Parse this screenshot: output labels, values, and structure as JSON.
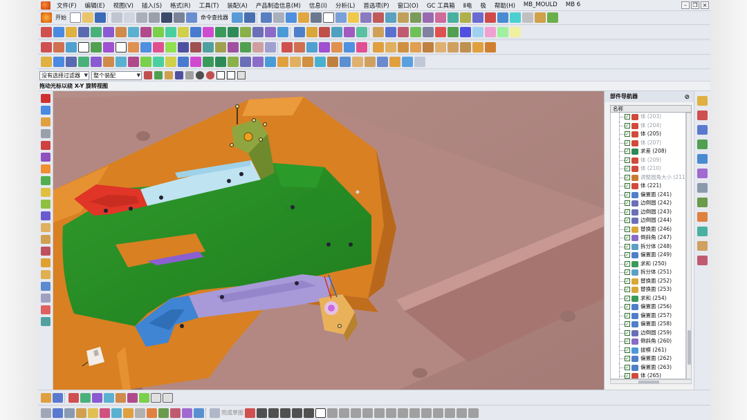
{
  "menu": [
    "文件(F)",
    "编辑(E)",
    "视图(V)",
    "插入(S)",
    "格式(R)",
    "工具(T)",
    "装配(A)",
    "产品制造信息(M)",
    "信息(I)",
    "分析(L)",
    "首选项(P)",
    "窗口(O)",
    "GC 工具箱",
    "Ⅱ电",
    "极",
    "帮助(H)",
    "MB_MOULD",
    "MB 6"
  ],
  "toolbar": {
    "start_label": "开始",
    "command_finder": "命令查找器"
  },
  "selection_bar": {
    "filter_value": "没有选择过滤器",
    "scope_value": "整个装配"
  },
  "status_text": "拖动光标以绕 X-Y 旋转视图",
  "bottom_toolbar": {
    "finish_sketch": "完成草图"
  },
  "navigator": {
    "title": "部件导航器",
    "column_name": "名称",
    "rows": [
      {
        "label": "体 (203)",
        "dim": true,
        "icon": "body"
      },
      {
        "label": "体 (204)",
        "dim": true,
        "icon": "body"
      },
      {
        "label": "体 (205)",
        "dim": false,
        "icon": "body"
      },
      {
        "label": "体 (207)",
        "dim": true,
        "icon": "body"
      },
      {
        "label": "求差 (208)",
        "dim": false,
        "icon": "subtract"
      },
      {
        "label": "体 (209)",
        "dim": true,
        "icon": "body"
      },
      {
        "label": "体 (210)",
        "dim": true,
        "icon": "body"
      },
      {
        "label": "调整圆角大小 (211)",
        "dim": true,
        "icon": "blend"
      },
      {
        "label": "体 (221)",
        "dim": false,
        "icon": "body"
      },
      {
        "label": "偏置面 (241)",
        "dim": false,
        "icon": "offset"
      },
      {
        "label": "边倒圆 (242)",
        "dim": false,
        "icon": "edgeblend"
      },
      {
        "label": "边倒圆 (243)",
        "dim": false,
        "icon": "edgeblend"
      },
      {
        "label": "边倒圆 (244)",
        "dim": false,
        "icon": "edgeblend"
      },
      {
        "label": "替换面 (246)",
        "dim": false,
        "icon": "replace"
      },
      {
        "label": "倒斜角 (247)",
        "dim": false,
        "icon": "chamfer"
      },
      {
        "label": "拆分体 (248)",
        "dim": false,
        "icon": "split"
      },
      {
        "label": "偏置面 (249)",
        "dim": false,
        "icon": "offset"
      },
      {
        "label": "求和 (250)",
        "dim": false,
        "icon": "unite"
      },
      {
        "label": "拆分体 (251)",
        "dim": false,
        "icon": "split"
      },
      {
        "label": "替换面 (252)",
        "dim": false,
        "icon": "replace"
      },
      {
        "label": "替换面 (253)",
        "dim": false,
        "icon": "replace"
      },
      {
        "label": "求和 (254)",
        "dim": false,
        "icon": "unite"
      },
      {
        "label": "偏置面 (256)",
        "dim": false,
        "icon": "offset"
      },
      {
        "label": "偏置面 (257)",
        "dim": false,
        "icon": "offset"
      },
      {
        "label": "偏置面 (258)",
        "dim": false,
        "icon": "offset"
      },
      {
        "label": "边倒圆 (259)",
        "dim": false,
        "icon": "edgeblend"
      },
      {
        "label": "倒斜角 (260)",
        "dim": false,
        "icon": "chamfer"
      },
      {
        "label": "拔模 (261)",
        "dim": false,
        "icon": "draft"
      },
      {
        "label": "偏置面 (262)",
        "dim": false,
        "icon": "offset"
      },
      {
        "label": "偏置面 (263)",
        "dim": false,
        "icon": "offset"
      },
      {
        "label": "体 (265)",
        "dim": false,
        "icon": "body"
      }
    ]
  },
  "icon_colors": {
    "body": "#d14a3a",
    "subtract": "#2e8b57",
    "blend": "#c87a30",
    "offset": "#4f7fc8",
    "edgeblend": "#6b6fb8",
    "replace": "#d9a63a",
    "chamfer": "#8a6bc7",
    "split": "#5aa0c8",
    "unite": "#3a9a5a",
    "draft": "#4a9ad8"
  }
}
